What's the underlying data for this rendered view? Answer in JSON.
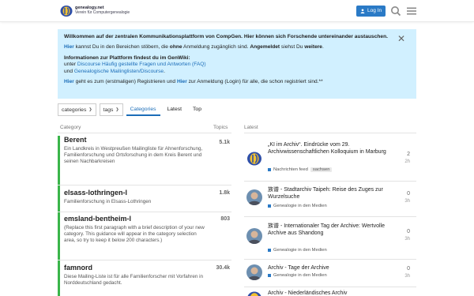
{
  "header": {
    "logo_line1": "genealogy.net",
    "logo_line2": "Verein für Computergenealogie",
    "login_label": "Log In"
  },
  "banner": {
    "intro": "Willkommen auf der zentralen Kommunikationsplattform von CompGen. Hier können sich Forschende untereinander austauschen.",
    "p2_link": "Hier",
    "p2_a": " kannst Du in den Bereichen stöbern, die ",
    "p2_ohne": "ohne",
    "p2_b": " Anmeldung zugänglich sind. ",
    "p2_angemeldet": "Angemeldet",
    "p2_c": " siehst Du ",
    "p2_weitere": "weitere",
    "p2_d": ".",
    "p3_title": "Informationen zur Plattform findest du im GenWiki:",
    "p3_unter": "unter ",
    "p3_link1": "Discourse Häufig gestellte Fragen und Antworten (FAQ)",
    "p3_und": "und ",
    "p3_link2": "Genealogische Mailinglisten/Discourse",
    "p3_end": ".",
    "p4_link1": "Hier",
    "p4_a": " geht es zum (erstmaligen) Registrieren und ",
    "p4_link2": "Hier",
    "p4_b": " zur Anmeldung (Login) für alle, die schon registriert sind.**"
  },
  "nav": {
    "dropdown1": "categories",
    "dropdown2": "tags",
    "tabs": [
      "Categories",
      "Latest",
      "Top"
    ]
  },
  "columns": {
    "category": "Category",
    "topics": "Topics",
    "latest": "Latest"
  },
  "categories": [
    {
      "name": "Berent",
      "count": "5.1k",
      "color": "#3ab54a",
      "desc": "Ein Landkreis in Westpreußen Mailingliste für Ahnenforschung, Familienforschung und Ortsforschung in dem Kreis Berent und seinen Nachbarkreisen"
    },
    {
      "name": "elsass-lothringen-l",
      "count": "1.8k",
      "color": "#3ab54a",
      "desc": "Familienforschung in Elsass-Lothringen"
    },
    {
      "name": "emsland-bentheim-l",
      "count": "803",
      "color": "#3ab54a",
      "desc": "(Replace this first paragraph with a brief description of your new category. This guidance will appear in the category selection area, so try to keep it below 200 characters.)"
    },
    {
      "name": "famnord",
      "count": "30.4k",
      "color": "#3ab54a",
      "desc": "Diese Mailing-Liste ist für alle Familienforscher mit Vorfahren in Norddeutschland gedacht."
    }
  ],
  "topics": [
    {
      "title": "„KI im Archiv“. Eindrücke vom 29. Archivwissenschaftlichen Kolloquium in Marburg",
      "category": "Nachrichten feed",
      "tag": "sachsen",
      "replies": "2",
      "age": "2h",
      "avatar": "logo"
    },
    {
      "title": "族谱 - Stadtarchiv Taipeh: Reise des Zuges zur Wurzelsuche",
      "category": "Genealogie in den Medien",
      "tag": "",
      "replies": "0",
      "age": "3h",
      "avatar": "person"
    },
    {
      "title": "族谱 - Internationaler Tag der Archive: Wertvolle Archive aus Shandong",
      "category": "Genealogie in den Medien",
      "tag": "",
      "replies": "0",
      "age": "3h",
      "avatar": "person"
    },
    {
      "title": "Archiv - Tage der Archive",
      "category": "Genealogie in den Medien",
      "tag": "",
      "replies": "0",
      "age": "3h",
      "avatar": "person"
    },
    {
      "title": "Archiv - Niederländisches Archiv",
      "category": "",
      "tag": "",
      "replies": "",
      "age": "",
      "avatar": "logo"
    }
  ]
}
